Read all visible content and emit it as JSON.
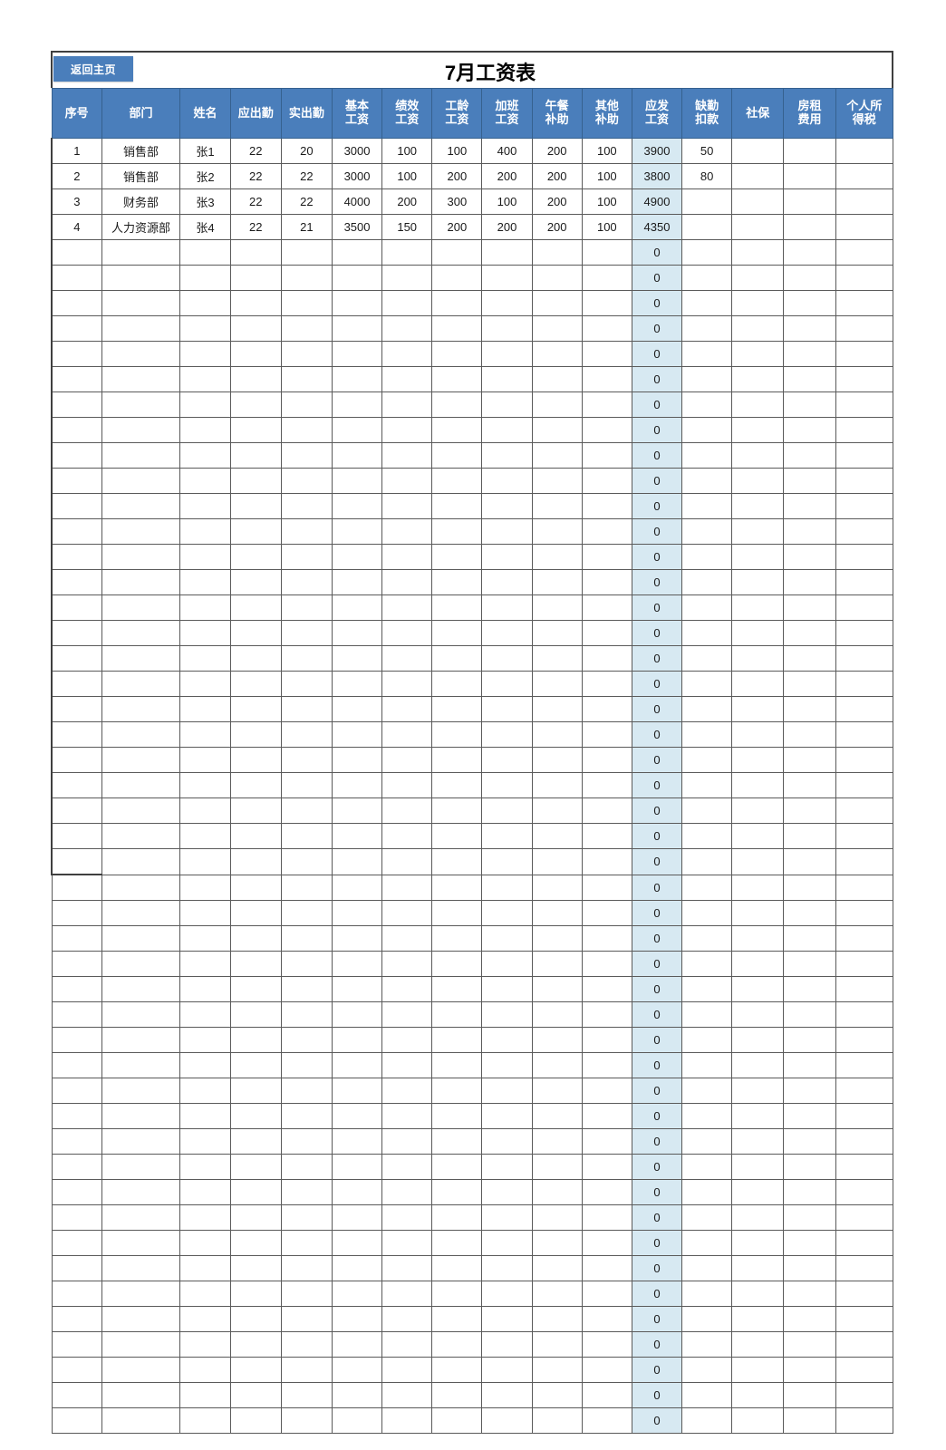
{
  "toolbar": {
    "home_button_label": "返回主页"
  },
  "header": {
    "title": "7月工资表"
  },
  "table": {
    "columns": [
      {
        "key": "idx",
        "line1": "序号",
        "line2": "",
        "width": "w-idx"
      },
      {
        "key": "dept",
        "line1": "部门",
        "line2": "",
        "width": "w-dept"
      },
      {
        "key": "name",
        "line1": "姓名",
        "line2": "",
        "width": "w-name"
      },
      {
        "key": "due_att",
        "line1": "应出勤",
        "line2": "",
        "width": "w-att"
      },
      {
        "key": "real_att",
        "line1": "实出勤",
        "line2": "",
        "width": "w-att"
      },
      {
        "key": "base",
        "line1": "基本",
        "line2": "工资",
        "width": "w-pay"
      },
      {
        "key": "perf",
        "line1": "绩效",
        "line2": "工资",
        "width": "w-pay"
      },
      {
        "key": "seniority",
        "line1": "工龄",
        "line2": "工资",
        "width": "w-pay"
      },
      {
        "key": "overtime",
        "line1": "加班",
        "line2": "工资",
        "width": "w-pay"
      },
      {
        "key": "lunch",
        "line1": "午餐",
        "line2": "补助",
        "width": "w-pay"
      },
      {
        "key": "other",
        "line1": "其他",
        "line2": "补助",
        "width": "w-pay"
      },
      {
        "key": "gross",
        "line1": "应发",
        "line2": "工资",
        "width": "w-pay"
      },
      {
        "key": "absence",
        "line1": "缺勤",
        "line2": "扣款",
        "width": "w-pay"
      },
      {
        "key": "social",
        "line1": "社保",
        "line2": "",
        "width": "w-si"
      },
      {
        "key": "rent",
        "line1": "房租",
        "line2": "费用",
        "width": "w-rent"
      },
      {
        "key": "tax",
        "line1": "个人所",
        "line2": "得税",
        "width": "w-tax"
      }
    ],
    "calc_column_index": 11,
    "rows": [
      [
        "1",
        "销售部",
        "张1",
        "22",
        "20",
        "3000",
        "100",
        "100",
        "400",
        "200",
        "100",
        "3900",
        "50",
        "",
        "",
        ""
      ],
      [
        "2",
        "销售部",
        "张2",
        "22",
        "22",
        "3000",
        "100",
        "200",
        "200",
        "200",
        "100",
        "3800",
        "80",
        "",
        "",
        ""
      ],
      [
        "3",
        "财务部",
        "张3",
        "22",
        "22",
        "4000",
        "200",
        "300",
        "100",
        "200",
        "100",
        "4900",
        "",
        "",
        "",
        ""
      ],
      [
        "4",
        "人力资源部",
        "张4",
        "22",
        "21",
        "3500",
        "150",
        "200",
        "200",
        "200",
        "100",
        "4350",
        "",
        "",
        "",
        ""
      ]
    ],
    "empty_row_gross_value": "0",
    "empty_rows_in_selection": 25,
    "empty_rows_below_selection": 22
  },
  "colors": {
    "header_blue": "#4a7ebb",
    "calc_cell_blue": "#d7e9f2",
    "grid_line": "#5a5a5a",
    "outline": "#3f3f3f",
    "page_background": "#ffffff"
  }
}
